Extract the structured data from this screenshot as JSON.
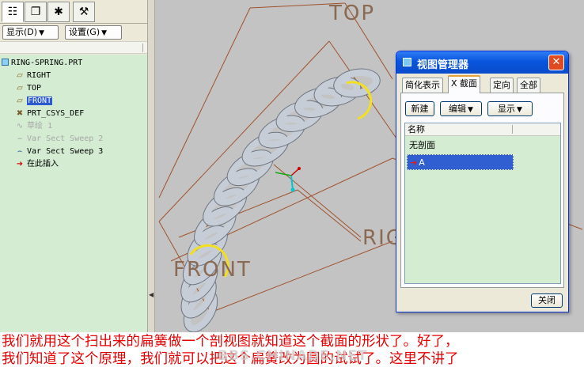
{
  "toolbar_tabs": [
    {
      "icon": "model-tree-icon",
      "glyph": "☷"
    },
    {
      "icon": "folder-layers-icon",
      "glyph": "❐"
    },
    {
      "icon": "favorites-star-icon",
      "glyph": "✱"
    },
    {
      "icon": "tools-icon",
      "glyph": "⚒"
    }
  ],
  "tree_toolbar": {
    "show_label": "显示(D)",
    "settings_label": "设置(G)"
  },
  "model_tree": {
    "root": "RING-SPRING.PRT",
    "items": [
      {
        "label": "RIGHT",
        "icon": "datum-plane-icon",
        "glyph": "▱",
        "state": "normal"
      },
      {
        "label": "TOP",
        "icon": "datum-plane-icon",
        "glyph": "▱",
        "state": "normal"
      },
      {
        "label": "FRONT",
        "icon": "datum-plane-icon",
        "glyph": "▱",
        "state": "selected"
      },
      {
        "label": "PRT_CSYS_DEF",
        "icon": "coordinate-system-icon",
        "glyph": "✖",
        "state": "normal"
      },
      {
        "label": "草绘 1",
        "icon": "sketch-icon",
        "glyph": "∿",
        "state": "dim"
      },
      {
        "label": "Var Sect Sweep 2",
        "icon": "sweep-feature-icon",
        "glyph": "⌢",
        "state": "dim"
      },
      {
        "label": "Var Sect Sweep 3",
        "icon": "sweep-feature-icon",
        "glyph": "⌢",
        "state": "normal"
      },
      {
        "label": "在此插入",
        "icon": "insert-here-arrow-icon",
        "glyph": "➜",
        "state": "insert"
      }
    ]
  },
  "viewport": {
    "labels": {
      "top": "TOP",
      "front": "FRONT",
      "right": "RIG"
    }
  },
  "view_manager": {
    "title": "视图管理器",
    "close_glyph": "✕",
    "tabs": [
      {
        "label": "简化表示",
        "active": false
      },
      {
        "label": "X 截面",
        "active": true
      },
      {
        "label": "定向",
        "active": false
      },
      {
        "label": "全部",
        "active": false
      }
    ],
    "buttons": {
      "new": "新建",
      "edit": "编辑",
      "display": "显示"
    },
    "list_header": "名称",
    "rows": [
      {
        "label": "无剖面",
        "selected": false
      },
      {
        "label": "A",
        "selected": true
      }
    ],
    "close_label": "关闭"
  },
  "caption": {
    "line1": "我们就用这个扫出来的扁簧做一个剖视图就知道这个截面的形状了。好了，",
    "line2": "我们知道了这个原理，我们就可以把这个扁簧改为圆的试试了。这里不讲了",
    "watermark": "BBS.CHINADE.NET"
  },
  "colors": {
    "tree_bg": "#d3ecd2",
    "viewport_bg": "#c3c3c3",
    "datum_line": "#a0522d",
    "spring_fill": "#c7cdd6",
    "caption_text": "#e60000",
    "dialog_title": "#0a56dd",
    "selection": "#2f5fd0"
  }
}
